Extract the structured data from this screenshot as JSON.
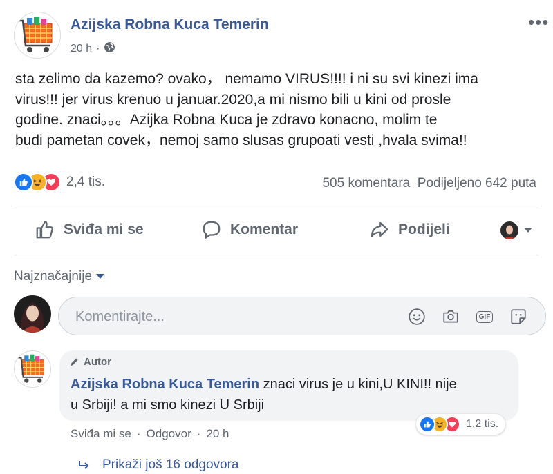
{
  "post": {
    "page_name": "Azijska Robna Kuca Temerin",
    "time": "20 h",
    "separator": "·",
    "privacy_icon": "globe-icon",
    "text_lines": [
      "sta zelimo da kazemo? ovako， nemamo VIRUS!!!! i ni su svi kinezi ima",
      "virus!!! jer virus krenuo u januar.2020,a mi nismo bili u kini od prosle",
      "godine. znaci。。。Azijka Robna Kuca je zdravo konacno, molim te",
      "budi pametan covek，nemoj samo slusas grupoati vesti ,hvala svima!!"
    ],
    "reaction_icons": [
      "like-icon",
      "haha-icon",
      "love-icon"
    ],
    "reactions_count": "2,4 tis.",
    "comments_count": "505 komentara",
    "shares_count": "Podijeljeno 642 puta"
  },
  "actions": {
    "like": "Sviđa mi se",
    "comment": "Komentar",
    "share": "Podijeli"
  },
  "comments": {
    "sort_label": "Najznačajnije",
    "input_placeholder": "Komentirajte...",
    "input_icons": [
      "emoji-icon",
      "camera-icon",
      "gif-icon",
      "sticker-icon"
    ],
    "gif_label": "GIF",
    "first": {
      "badge": "Autor",
      "author": "Azijska Robna Kuca Temerin",
      "text_line1": " znaci virus je u kini,U KINI!! nije",
      "text_line2": "u Srbiji! a mi smo kinezi U Srbiji",
      "reactions_count": "1,2 tis.",
      "like": "Sviđa mi se",
      "reply": "Odgovor",
      "separator": "·",
      "time": "20 h"
    },
    "view_replies": "Prikaži još 16 odgovora"
  },
  "colors": {
    "link_blue": "#385898",
    "like_blue": "#1877f2",
    "haha_yellow": "#f7b125",
    "love_red": "#f33e58",
    "secondary_text": "#606770"
  }
}
